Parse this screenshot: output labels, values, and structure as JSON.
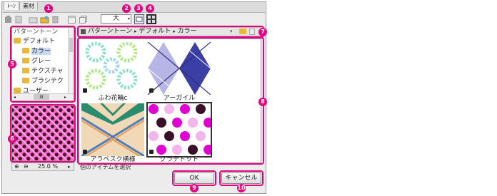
{
  "tabs": [
    {
      "label": "ﾄｰﾝ"
    },
    {
      "label": "素材"
    }
  ],
  "toolbar": {
    "size_value": "大",
    "icons": [
      "delete-icon",
      "new-icon",
      "open-folder-icon",
      "folder-star-icon",
      "trash-icon",
      "window-icon",
      "window-duplicate-icon",
      "detail-view-icon",
      "thumbnail-view-icon"
    ]
  },
  "callouts": [
    "1",
    "2",
    "3",
    "4",
    "5",
    "6",
    "7",
    "8",
    "9",
    "10"
  ],
  "tree": {
    "items": [
      {
        "label": "パターントーン"
      },
      {
        "label": "デフォルト"
      },
      {
        "label": "カラー"
      },
      {
        "label": "グレー"
      },
      {
        "label": "テクスチャ"
      },
      {
        "label": "ブラシテク"
      },
      {
        "label": "ユーザー"
      }
    ],
    "scroll_label": "III"
  },
  "path": {
    "segments": [
      "パターントーン",
      "デフォルト",
      "カラー"
    ],
    "separator": "▸"
  },
  "thumbnails": [
    {
      "caption": "ふわ花輪c"
    },
    {
      "caption": "アーガイル"
    },
    {
      "caption": "アラベスク横様"
    },
    {
      "caption": "グラデドット"
    }
  ],
  "status_text": "個のアイテムを選択",
  "zoom": {
    "value": "25.0 %"
  },
  "buttons": {
    "ok": "OK",
    "cancel": "キャンセル"
  },
  "colors": {
    "accent": "#e4007f"
  }
}
